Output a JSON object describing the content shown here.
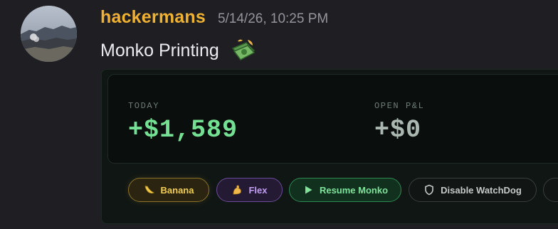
{
  "message": {
    "username": "hackermans",
    "timestamp": "5/14/26, 10:25 PM",
    "content": "Monko Printing",
    "emoji": "money-with-wings-emoji"
  },
  "embed": {
    "stats": {
      "today_label": "TODAY",
      "today_value": "+$1,589",
      "pnl_label": "OPEN P&L",
      "pnl_value": "+$0"
    },
    "buttons": [
      {
        "label": "Banana",
        "icon": "banana-icon",
        "color": "#f2ce55"
      },
      {
        "label": "Flex",
        "icon": "flexed-bicep-icon",
        "color": "#c39cf5"
      },
      {
        "label": "Resume Monko",
        "icon": "play-icon",
        "color": "#7fe39b"
      },
      {
        "label": "Disable WatchDog",
        "icon": "shield-icon",
        "color": "#c6cbc9"
      }
    ]
  },
  "colors": {
    "background": "#1f1f23",
    "username": "#f0b232",
    "timestamp": "#94959c",
    "today_value": "#74e094",
    "pnl_value": "#aab8b1"
  }
}
